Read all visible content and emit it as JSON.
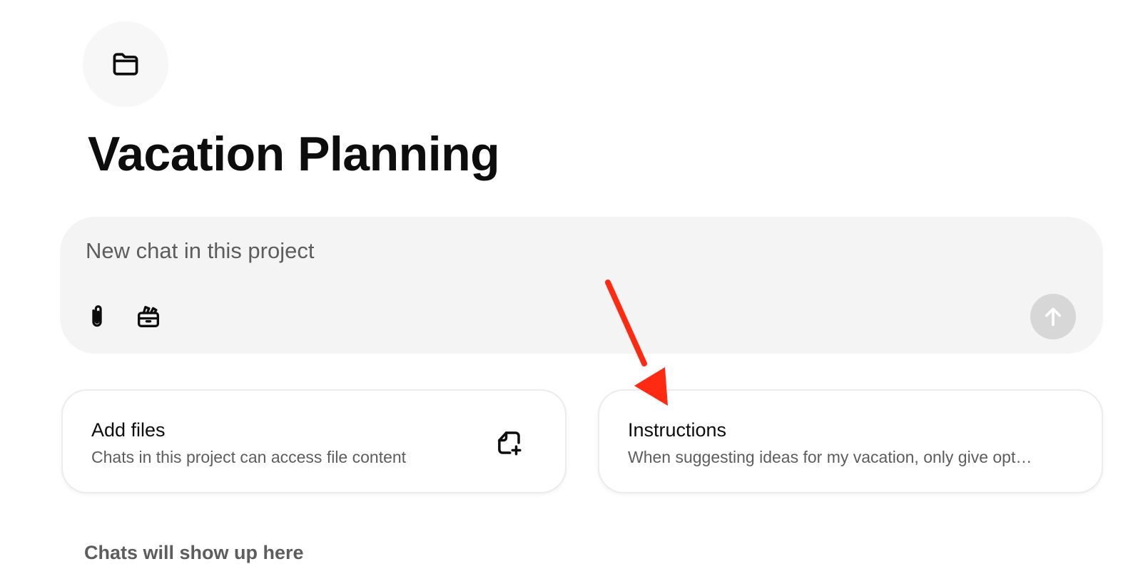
{
  "project": {
    "icon": "folder-icon",
    "title": "Vacation Planning"
  },
  "composer": {
    "placeholder": "New chat in this project",
    "attach_icon": "paperclip-icon",
    "tools_icon": "toolbox-icon",
    "send_icon": "arrow-up-icon"
  },
  "cards": {
    "files": {
      "title": "Add files",
      "description": "Chats in this project can access file content",
      "icon": "file-add-icon"
    },
    "instructions": {
      "title": "Instructions",
      "description": "When suggesting ideas for my vacation, only give opt…"
    }
  },
  "section": {
    "label": "Chats will show up here"
  },
  "colors": {
    "composer_bg": "#f4f4f4",
    "send_disabled": "#d7d7d7",
    "annotation_arrow": "#ff2a12"
  }
}
